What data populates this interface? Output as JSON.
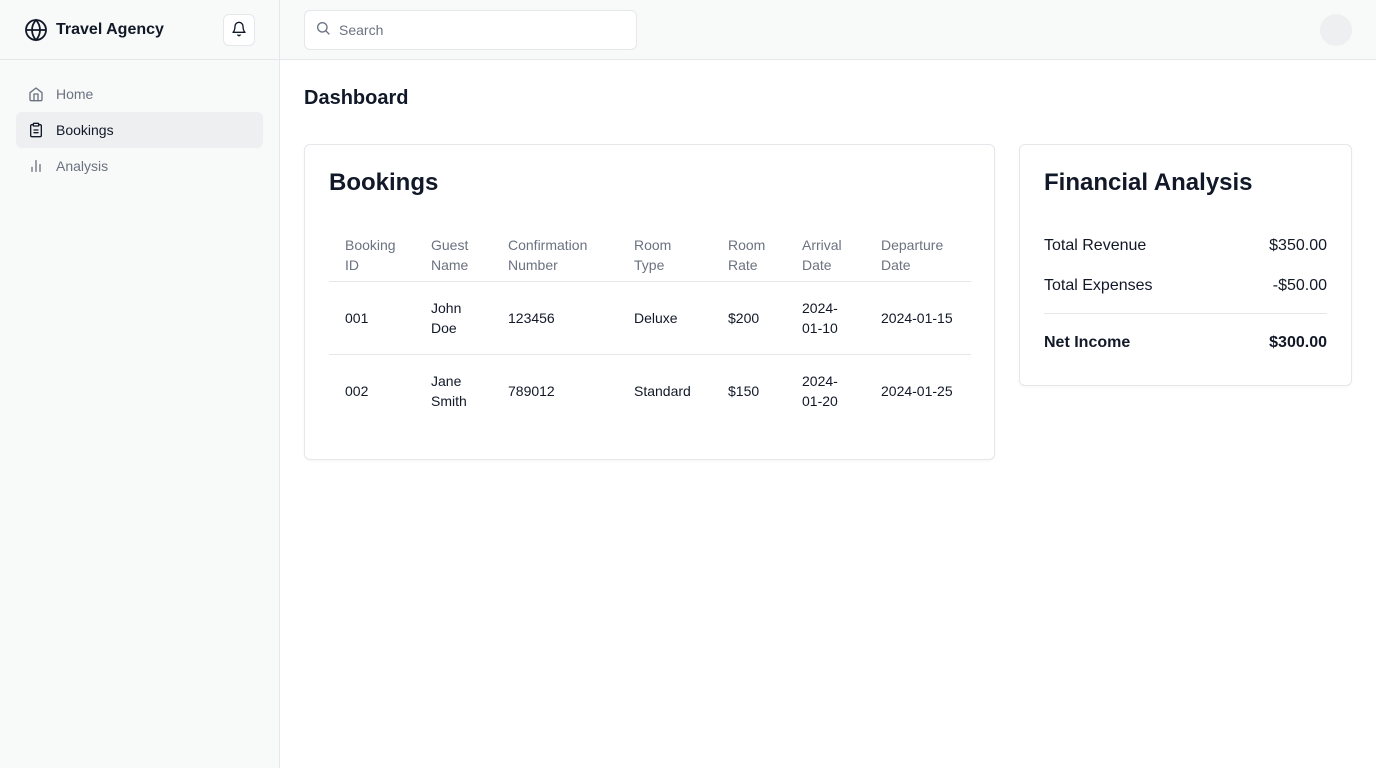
{
  "sidebar": {
    "brand": "Travel Agency",
    "brand_icon": "globe-icon",
    "items": [
      {
        "label": "Home",
        "icon": "home-icon"
      },
      {
        "label": "Bookings",
        "icon": "clipboard-icon"
      },
      {
        "label": "Analysis",
        "icon": "bar-chart-icon"
      }
    ]
  },
  "topbar": {
    "search_placeholder": "Search"
  },
  "page": {
    "title": "Dashboard"
  },
  "bookings": {
    "title": "Bookings",
    "columns": [
      "Booking ID",
      "Guest Name",
      "Confirmation Number",
      "Room Type",
      "Room Rate",
      "Arrival Date",
      "Departure Date"
    ],
    "rows": [
      [
        "001",
        "John Doe",
        "123456",
        "Deluxe",
        "$200",
        "2024-01-10",
        "2024-01-15"
      ],
      [
        "002",
        "Jane Smith",
        "789012",
        "Standard",
        "$150",
        "2024-01-20",
        "2024-01-25"
      ]
    ]
  },
  "financial": {
    "title": "Financial Analysis",
    "revenue_label": "Total Revenue",
    "revenue_value": "$350.00",
    "expenses_label": "Total Expenses",
    "expenses_value": "-$50.00",
    "net_label": "Net Income",
    "net_value": "$300.00"
  },
  "colors": {
    "sidebar_bg": "#f8f9f9",
    "active_bg": "#eeeff1",
    "border": "#e5e7eb",
    "muted_text": "#6b7280",
    "text": "#111827"
  }
}
